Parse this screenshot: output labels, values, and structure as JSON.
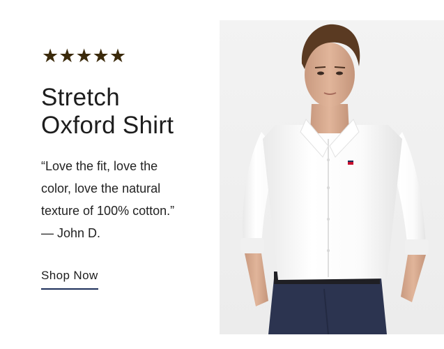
{
  "rating": {
    "stars": 5,
    "glyph": "★"
  },
  "product": {
    "title_lines": [
      "Stretch",
      "Oxford Shirt"
    ]
  },
  "review": {
    "lines": [
      "“Love the fit, love the",
      "color, love the natural",
      "texture of 100% cotton.”",
      "— John D."
    ]
  },
  "cta": {
    "label": "Shop Now",
    "underline_color": "#1c2f5a"
  },
  "photo": {
    "subject": "model wearing white oxford shirt and navy trousers"
  },
  "colors": {
    "star": "#3b2a0b",
    "text": "#1d1d1d",
    "accent": "#1c2f5a"
  }
}
